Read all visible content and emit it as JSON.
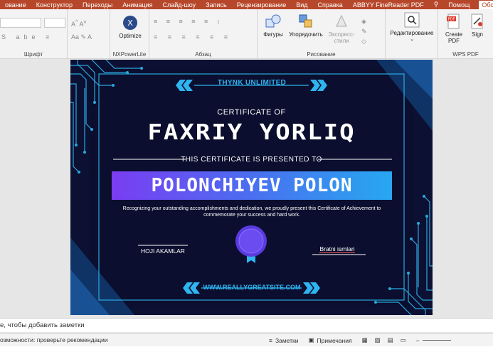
{
  "menu": {
    "tabs": [
      "ование",
      "Конструктор",
      "Переходы",
      "Анимация",
      "Слайд-шоу",
      "Запись",
      "Рецензирование",
      "Вид",
      "Справка",
      "ABBYY FineReader PDF",
      "Помощ"
    ],
    "share_label": "Обс"
  },
  "ribbon": {
    "groups": {
      "font": "Шрифт",
      "nxpowerlite": "NXPowerLite",
      "paragraph": "Абзац",
      "drawing": "Рисование",
      "wps_pdf": "WPS PDF"
    },
    "buttons": {
      "optimize": "Optimize",
      "shapes": "Фигуры",
      "arrange": "Упорядочить",
      "express_styles": "Экспресс-стили",
      "editing": "Редактирование",
      "create_pdf": "Create PDF",
      "sign": "Sign"
    }
  },
  "slide": {
    "brand": "THYNK UNLIMITED",
    "certificate_of": "CERTIFICATE OF",
    "title": "FAXRIY YORLIQ",
    "presented_to": "THIS CERTIFICATE IS PRESENTED TO",
    "recipient": "POLONCHIYEV POLON",
    "description": "Recognizing your outstanding accomplishments and dedication, we proudly present this Certificate of Achievement to commemorate your success and hard work.",
    "signer_left": "HOJI AKAMLAR",
    "signer_right": "Bratni ismlari",
    "website": "WWW.REALLYGREATSITE.COM"
  },
  "notes": {
    "placeholder": "е, чтобы добавить заметки"
  },
  "status": {
    "accessibility": "озможности: проверьте рекомендации",
    "notes_btn": "Заметки",
    "comments_btn": "Примечания"
  },
  "colors": {
    "ribbon_accent": "#b7472a",
    "slide_bg": "#0b0e2e",
    "cyan": "#2fb4f0",
    "band_start": "#7a3df2",
    "band_end": "#27a8f0",
    "badge": "#5a3be0"
  }
}
